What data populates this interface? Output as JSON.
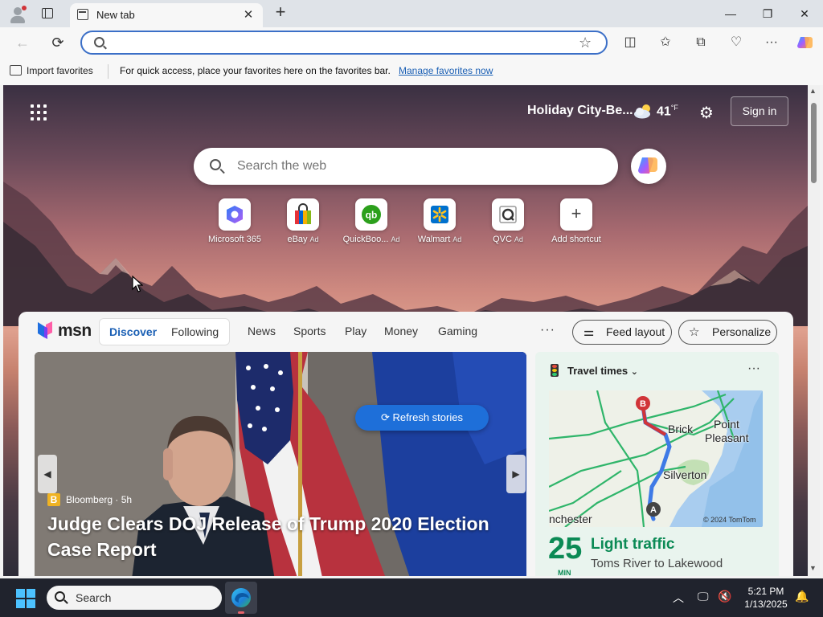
{
  "browser": {
    "tab_title": "New tab",
    "address_value": "",
    "address_placeholder": ""
  },
  "favorites_bar": {
    "import_label": "Import favorites",
    "message": "For quick access, place your favorites here on the favorites bar.",
    "manage_link": "Manage favorites now"
  },
  "ntp": {
    "location": "Holiday City-Be...",
    "temperature": "41",
    "temperature_unit": "°F",
    "sign_in": "Sign in",
    "search_placeholder": "Search the web",
    "shortcuts": [
      {
        "label": "Microsoft 365",
        "ad": ""
      },
      {
        "label": "eBay",
        "ad": "Ad"
      },
      {
        "label": "QuickBoo...",
        "ad": "Ad"
      },
      {
        "label": "Walmart",
        "ad": "Ad"
      },
      {
        "label": "QVC",
        "ad": "Ad"
      },
      {
        "label": "Add shortcut",
        "ad": ""
      }
    ]
  },
  "feed": {
    "logo_text": "msn",
    "tabs": {
      "discover": "Discover",
      "following": "Following"
    },
    "nav": [
      "News",
      "Sports",
      "Play",
      "Money",
      "Gaming"
    ],
    "more": "···",
    "feed_layout": "Feed layout",
    "personalize": "Personalize",
    "refresh": "Refresh stories",
    "hero": {
      "source": "Bloomberg",
      "age": "· 5h",
      "headline": "Judge Clears DOJ Release of Trump 2020 Election Case Report"
    },
    "travel": {
      "title": "Travel times",
      "map_labels": [
        "Brick",
        "Point",
        "Pleasant",
        "Silverton",
        "nchester"
      ],
      "map_copyright": "© 2024 TomTom",
      "minutes": "25",
      "min_label": "MIN",
      "status": "Light traffic",
      "route": "Toms River to Lakewood"
    }
  },
  "taskbar": {
    "search_label": "Search",
    "time": "5:21 PM",
    "date": "1/13/2025"
  },
  "colors": {
    "accent": "#1a5fb4",
    "refresh_button": "#1e6fd9",
    "traffic_green": "#0b8a55",
    "taskbar": "#20232d"
  }
}
